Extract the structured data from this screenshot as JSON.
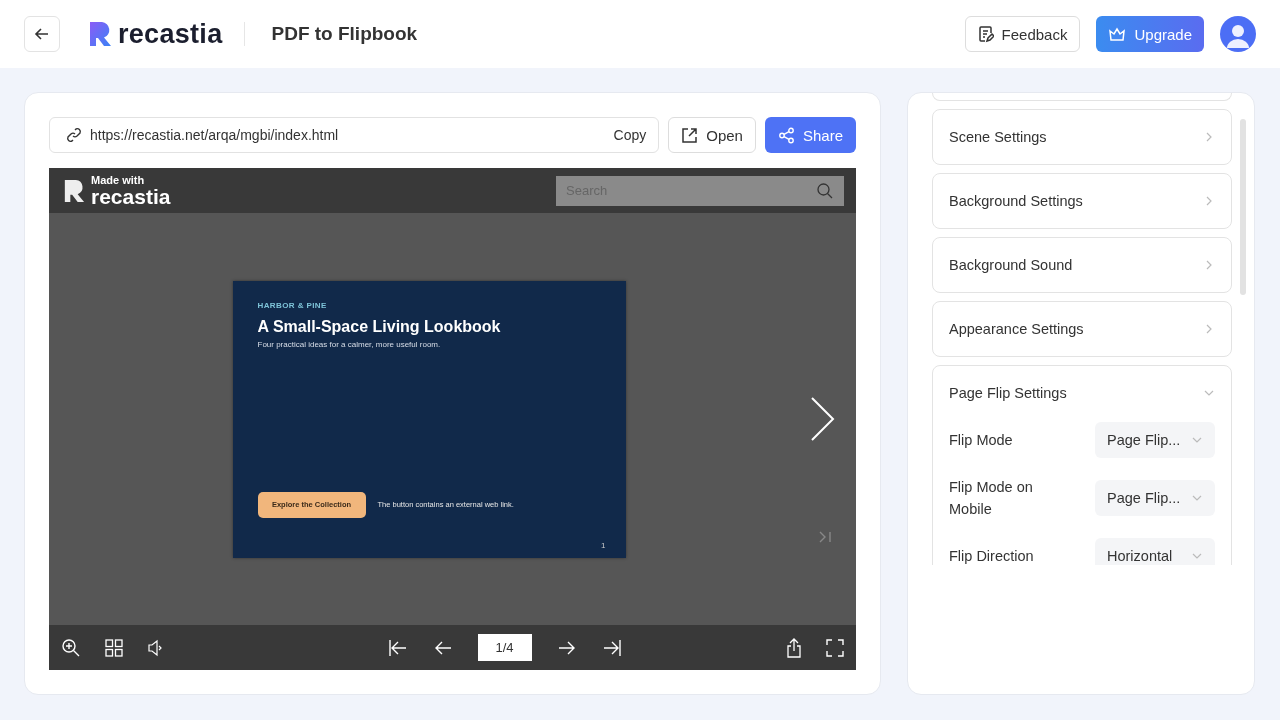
{
  "header": {
    "logo": "recastia",
    "title": "PDF to Flipbook",
    "buttons": [
      {
        "label": "Feedback",
        "kind": "outline"
      },
      {
        "label": "Upgrade",
        "kind": "primary"
      }
    ]
  },
  "link_bar": {
    "url": "https://recastia.net/arqa/mgbi/index.html",
    "copy": "Copy",
    "open": "Open",
    "share": "Share"
  },
  "viewer": {
    "badge_top": "Made with",
    "badge_logo": "recastia",
    "search": {
      "placeholder": "Search"
    },
    "page": {
      "brand": "HARBOR & PINE",
      "title": "A Small-Space Living Lookbook",
      "subtitle": "Four practical ideas for a calmer, more useful room.",
      "cta": "Explore the Collection",
      "note": "The button contains an external web link.",
      "number": "1"
    },
    "page_indicator": "1/4"
  },
  "settings": {
    "sections": [
      {
        "label": "Scene Settings",
        "expanded": false
      },
      {
        "label": "Background Settings",
        "expanded": false
      },
      {
        "label": "Background Sound",
        "expanded": false
      },
      {
        "label": "Appearance Settings",
        "expanded": false
      },
      {
        "label": "Page Flip Settings",
        "expanded": true,
        "options": [
          {
            "label": "Flip Mode",
            "value": "Page Flip..."
          },
          {
            "label": "Flip Mode on Mobile",
            "value": "Page Flip..."
          },
          {
            "label": "Flip Direction",
            "value": "Horizontal"
          }
        ]
      }
    ]
  }
}
